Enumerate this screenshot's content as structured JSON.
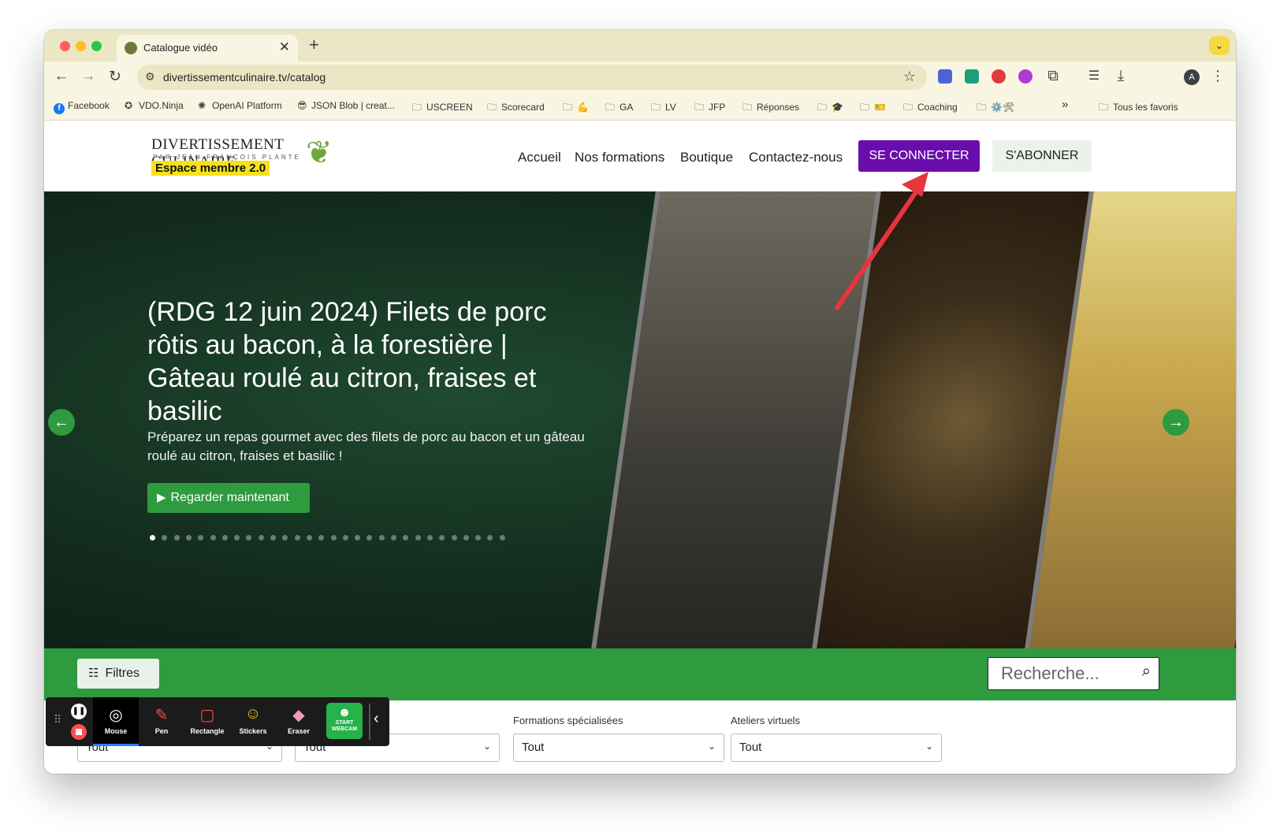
{
  "browser": {
    "tab_title": "Catalogue vidéo",
    "tab_close": "✕",
    "new_tab": "+",
    "tab_menu": "⌄",
    "url": "divertissementculinaire.tv/catalog",
    "avatar_initial": "A",
    "bookmarks": [
      {
        "label": "Facebook",
        "icon": "facebook-icon"
      },
      {
        "label": "VDO.Ninja",
        "icon": "vdo-ninja-icon"
      },
      {
        "label": "OpenAI Platform",
        "icon": "openai-icon"
      },
      {
        "label": "JSON Blob | creat...",
        "icon": "json-blob-icon"
      },
      {
        "label": "USCREEN",
        "icon": "folder-icon"
      },
      {
        "label": "Scorecard",
        "icon": "folder-icon"
      },
      {
        "label": "💪",
        "icon": "folder-icon"
      },
      {
        "label": "GA",
        "icon": "folder-icon"
      },
      {
        "label": "LV",
        "icon": "folder-icon"
      },
      {
        "label": "JFP",
        "icon": "folder-icon"
      },
      {
        "label": "Réponses",
        "icon": "folder-icon"
      },
      {
        "label": "🎓",
        "icon": "folder-icon"
      },
      {
        "label": "🎫",
        "icon": "folder-icon"
      },
      {
        "label": "Coaching",
        "icon": "folder-icon"
      },
      {
        "label": "⚙️🛠",
        "icon": "folder-icon"
      }
    ],
    "bookmarks_overflow": "»",
    "all_bookmarks": "Tous les favoris"
  },
  "site": {
    "logo_main": "DIVERTISSEMENT CULINAIRE",
    "logo_sub": "PAR JEAN-FRANÇOIS PLANTE",
    "logo_badge": "Espace membre 2.0",
    "nav": [
      "Accueil",
      "Nos formations",
      "Boutique",
      "Contactez-nous"
    ],
    "connect": "SE CONNECTER",
    "subscribe": "S'ABONNER"
  },
  "hero": {
    "title": "(RDG 12 juin 2024) Filets de porc rôtis au bacon, à la forestière | Gâteau roulé au citron, fraises et basilic",
    "description": "Préparez un repas gourmet avec des filets de porc au bacon et un gâteau roulé au citron, fraises et basilic !",
    "cta": "Regarder maintenant",
    "slide_count": 30,
    "active_slide": 1
  },
  "filters": {
    "button": "Filtres",
    "search_placeholder": "Recherche...",
    "selects": [
      {
        "label": "",
        "value": "Tout"
      },
      {
        "label": "",
        "value": "Tout"
      },
      {
        "label": "Formations spécialisées",
        "value": "Tout"
      },
      {
        "label": "Ateliers virtuels",
        "value": "Tout"
      }
    ]
  },
  "recorder": {
    "tools": [
      {
        "label": "Mouse",
        "icon": "mouse-icon",
        "active": true
      },
      {
        "label": "Pen",
        "icon": "pen-icon"
      },
      {
        "label": "Rectangle",
        "icon": "rectangle-icon"
      },
      {
        "label": "Stickers",
        "icon": "stickers-icon"
      },
      {
        "label": "Eraser",
        "icon": "eraser-icon"
      }
    ],
    "webcam_label": "START WEBCAM"
  },
  "colors": {
    "brand_green": "#2e9b3e",
    "connect_purple": "#6a0dad",
    "annotation_red": "#e8343f"
  }
}
